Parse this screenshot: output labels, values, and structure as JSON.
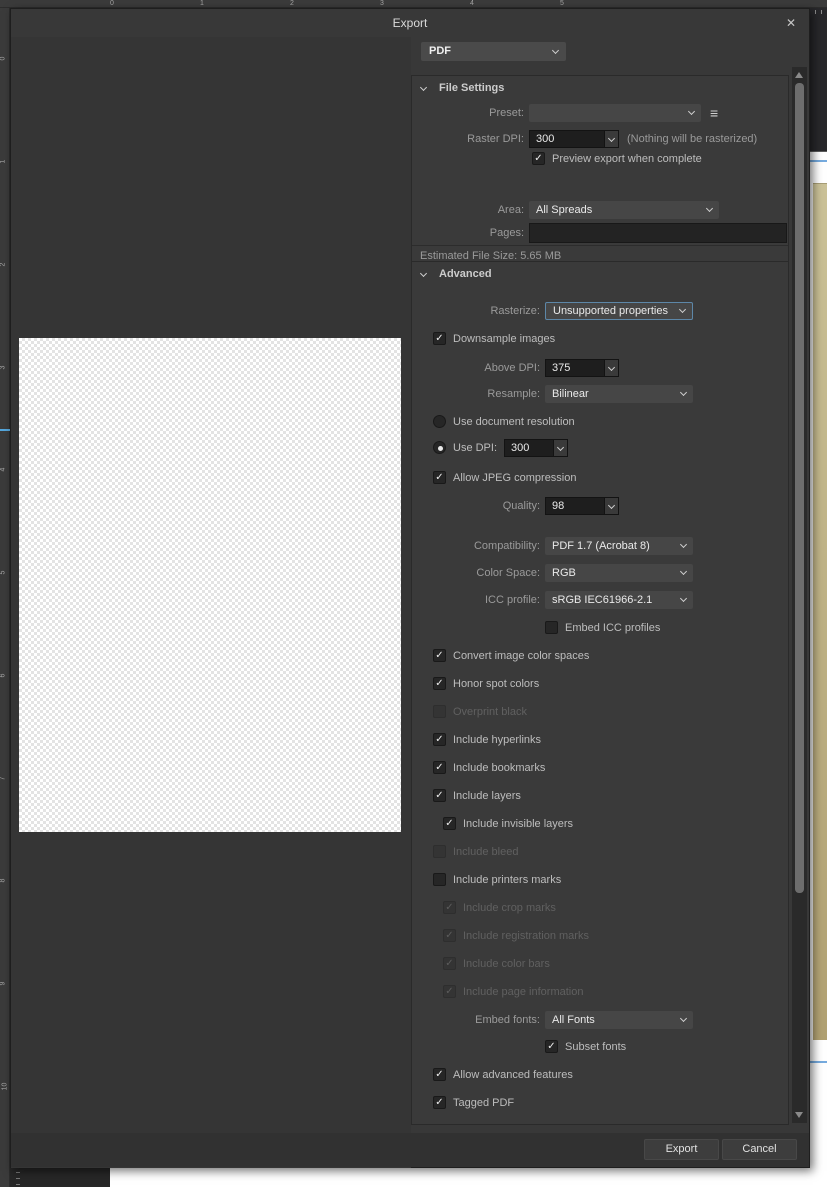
{
  "colors": {
    "accent_focus": "#5d87a8",
    "guide_blue": "#76abdf",
    "page_tan_top": "#cbc298",
    "page_tan_bottom": "#b1a172",
    "guide_marker_cyan": "#55a7dd"
  },
  "app": {
    "rulers": {
      "top_numbers": [
        "0",
        "1",
        "2",
        "3",
        "4",
        "5"
      ],
      "left_numbers": [
        "0",
        "1",
        "2",
        "3",
        "4",
        "5",
        "6",
        "7",
        "8",
        "9",
        "10"
      ]
    }
  },
  "dialog": {
    "title": "Export",
    "close_icon": "✕",
    "check_glyph": "✓",
    "format_select": {
      "value": "PDF"
    },
    "sections": [
      {
        "title": "File Settings",
        "rows": [
          {
            "kind": "select",
            "label": "Preset:",
            "value": "",
            "menu_icon": "≡"
          },
          {
            "kind": "combo",
            "label": "Raster DPI:",
            "value": "300",
            "note": "(Nothing will be rasterized)"
          },
          {
            "kind": "checkbox",
            "label": "Preview export when complete",
            "checked": true,
            "indent": 1
          },
          {
            "kind": "select",
            "label": "Area:",
            "value": "All Spreads"
          },
          {
            "kind": "input",
            "label": "Pages:",
            "value": ""
          },
          {
            "kind": "status",
            "text": "Estimated File Size: 5.65 MB"
          }
        ]
      },
      {
        "title": "Advanced",
        "rows": [
          {
            "kind": "select",
            "label": "Rasterize:",
            "value": "Unsupported properties",
            "focused": true
          },
          {
            "kind": "checkbox",
            "label": "Downsample images",
            "checked": true
          },
          {
            "kind": "combo",
            "label": "Above DPI:",
            "value": "375"
          },
          {
            "kind": "select",
            "label": "Resample:",
            "value": "Bilinear"
          },
          {
            "kind": "radio",
            "label": "Use document resolution",
            "checked": false
          },
          {
            "kind": "radio",
            "label": "Use DPI:",
            "checked": true,
            "combo_value": "300"
          },
          {
            "kind": "checkbox",
            "label": "Allow JPEG compression",
            "checked": true
          },
          {
            "kind": "combo",
            "label": "Quality:",
            "value": "98"
          },
          {
            "kind": "select",
            "label": "Compatibility:",
            "value": "PDF 1.7 (Acrobat 8)"
          },
          {
            "kind": "select",
            "label": "Color Space:",
            "value": "RGB"
          },
          {
            "kind": "select",
            "label": "ICC profile:",
            "value": "sRGB IEC61966-2.1"
          },
          {
            "kind": "checkbox",
            "label": "Embed ICC profiles",
            "checked": false,
            "indent": 2
          },
          {
            "kind": "checkbox",
            "label": "Convert image color spaces",
            "checked": true
          },
          {
            "kind": "checkbox",
            "label": "Honor spot colors",
            "checked": true
          },
          {
            "kind": "checkbox",
            "label": "Overprint black",
            "checked": false,
            "disabled": true
          },
          {
            "kind": "checkbox",
            "label": "Include hyperlinks",
            "checked": true
          },
          {
            "kind": "checkbox",
            "label": "Include bookmarks",
            "checked": true
          },
          {
            "kind": "checkbox",
            "label": "Include layers",
            "checked": true
          },
          {
            "kind": "checkbox",
            "label": "Include invisible layers",
            "checked": true,
            "indent": 1
          },
          {
            "kind": "checkbox",
            "label": "Include bleed",
            "checked": false,
            "disabled": true
          },
          {
            "kind": "checkbox",
            "label": "Include printers marks",
            "checked": false
          },
          {
            "kind": "checkbox",
            "label": "Include crop marks",
            "checked": true,
            "disabled": true,
            "indent": 1
          },
          {
            "kind": "checkbox",
            "label": "Include registration marks",
            "checked": true,
            "disabled": true,
            "indent": 1
          },
          {
            "kind": "checkbox",
            "label": "Include color bars",
            "checked": true,
            "disabled": true,
            "indent": 1
          },
          {
            "kind": "checkbox",
            "label": "Include page information",
            "checked": true,
            "disabled": true,
            "indent": 1
          },
          {
            "kind": "select",
            "label": "Embed fonts:",
            "value": "All Fonts"
          },
          {
            "kind": "checkbox",
            "label": "Subset fonts",
            "checked": true,
            "indent": 2
          },
          {
            "kind": "checkbox",
            "label": "Allow advanced features",
            "checked": true
          },
          {
            "kind": "checkbox",
            "label": "Tagged PDF",
            "checked": true
          }
        ]
      }
    ],
    "footer": {
      "export_label": "Export",
      "cancel_label": "Cancel"
    }
  }
}
